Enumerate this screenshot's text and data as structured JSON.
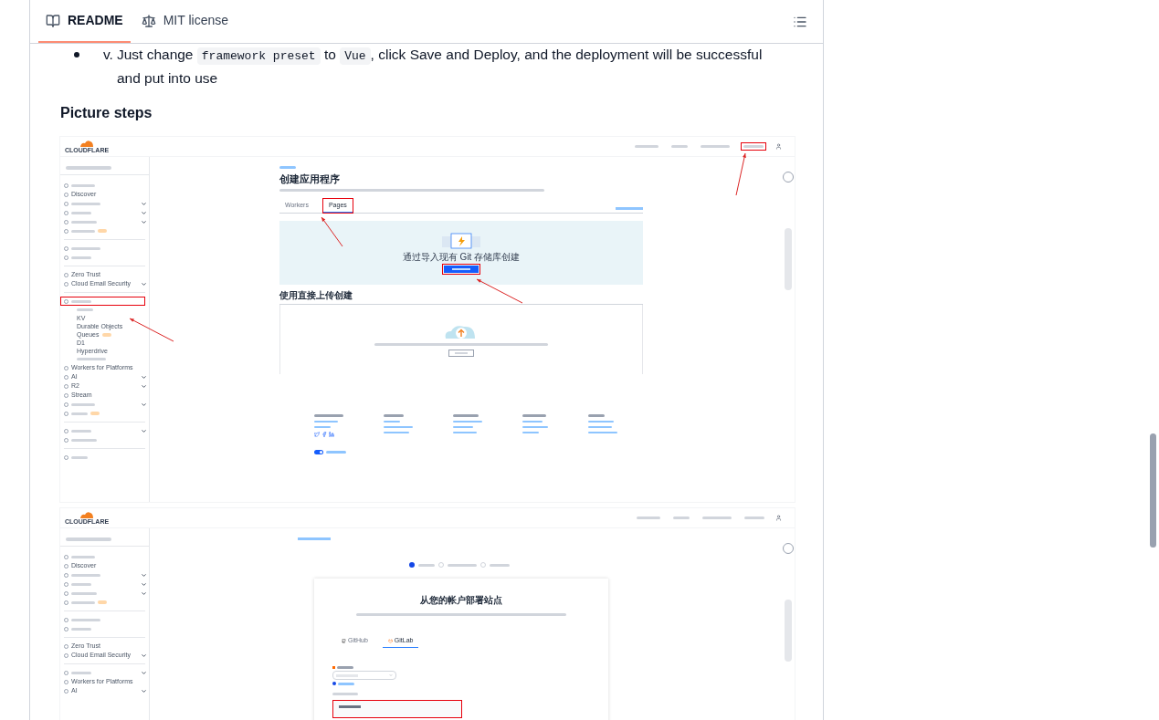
{
  "tabs": [
    {
      "label": "README",
      "selected": true
    },
    {
      "label": "MIT license",
      "selected": false
    }
  ],
  "list_item": {
    "marker": "v.",
    "parts": [
      {
        "kind": "text",
        "text": "Just change "
      },
      {
        "kind": "code",
        "text": "framework preset"
      },
      {
        "kind": "text",
        "text": " to "
      },
      {
        "kind": "code",
        "text": "Vue"
      },
      {
        "kind": "text",
        "text": ", click Save and Deploy, and the deployment will be successful and put into use"
      }
    ]
  },
  "heading": "Picture steps",
  "screenshots": [
    {
      "kind": "create-app",
      "logo": "CLOUDFLARE",
      "topbar": [
        {
          "highlighted": false
        },
        {
          "highlighted": false
        },
        {
          "highlighted": false
        },
        {
          "highlighted": true
        }
      ],
      "sidebar": [
        {
          "kind": "blurred",
          "chevron": false,
          "badge": false,
          "highlighted": false
        },
        {
          "kind": "label",
          "label": "Discover",
          "chevron": false,
          "badge": false,
          "highlighted": false
        },
        {
          "kind": "blurred",
          "chevron": true,
          "badge": false,
          "highlighted": false
        },
        {
          "kind": "blurred",
          "chevron": true,
          "badge": false,
          "highlighted": false
        },
        {
          "kind": "blurred",
          "chevron": true,
          "badge": false,
          "highlighted": false
        },
        {
          "kind": "blurred",
          "chevron": false,
          "badge": true,
          "highlighted": false
        },
        {
          "kind": "divider"
        },
        {
          "kind": "blurred",
          "chevron": false,
          "badge": false,
          "highlighted": false
        },
        {
          "kind": "blurred",
          "chevron": false,
          "badge": false,
          "highlighted": false
        },
        {
          "kind": "divider"
        },
        {
          "kind": "label",
          "label": "Zero Trust",
          "chevron": false,
          "badge": false,
          "highlighted": false
        },
        {
          "kind": "label",
          "label": "Cloud Email Security",
          "chevron": true,
          "badge": false,
          "highlighted": false
        },
        {
          "kind": "divider"
        },
        {
          "kind": "blurred",
          "chevron": false,
          "badge": false,
          "highlighted": true
        },
        {
          "kind": "sub",
          "badge": false
        },
        {
          "kind": "sub",
          "label": "KV",
          "badge": false
        },
        {
          "kind": "sub",
          "label": "Durable Objects",
          "badge": false
        },
        {
          "kind": "sub",
          "label": "Queues",
          "badge": true
        },
        {
          "kind": "sub",
          "label": "D1",
          "badge": false
        },
        {
          "kind": "sub",
          "label": "Hyperdrive",
          "badge": false
        },
        {
          "kind": "sub",
          "badge": false
        },
        {
          "kind": "label",
          "label": "Workers for Platforms",
          "chevron": false,
          "badge": false,
          "highlighted": false
        },
        {
          "kind": "label",
          "label": "AI",
          "chevron": true,
          "badge": false,
          "highlighted": false
        },
        {
          "kind": "label",
          "label": "R2",
          "chevron": true,
          "badge": false,
          "highlighted": false
        },
        {
          "kind": "label",
          "label": "Stream",
          "chevron": false,
          "badge": false,
          "highlighted": false
        },
        {
          "kind": "blurred",
          "chevron": true,
          "badge": false,
          "highlighted": false
        },
        {
          "kind": "blurred",
          "chevron": false,
          "badge": true,
          "highlighted": false
        },
        {
          "kind": "divider"
        },
        {
          "kind": "blurred",
          "chevron": true,
          "badge": false,
          "highlighted": false
        },
        {
          "kind": "blurred",
          "chevron": false,
          "badge": false,
          "highlighted": false
        },
        {
          "kind": "divider"
        },
        {
          "kind": "blurred",
          "chevron": false,
          "badge": false,
          "highlighted": false
        }
      ],
      "title": "创建应用程序",
      "tabs": [
        {
          "label": "Workers",
          "selected": false,
          "highlighted": false
        },
        {
          "label": "Pages",
          "selected": true,
          "highlighted": true
        }
      ],
      "git_text": "通过导入现有 Git 存储库创建",
      "upload_heading": "使用直接上传创建",
      "cookie_toggle": {
        "on": true
      }
    },
    {
      "kind": "deploy-site",
      "logo": "CLOUDFLARE",
      "topbar": [
        {
          "highlighted": false
        },
        {
          "highlighted": false
        },
        {
          "highlighted": false
        },
        {
          "highlighted": false
        }
      ],
      "sidebar": [
        {
          "kind": "blurred",
          "chevron": false,
          "badge": false,
          "highlighted": false
        },
        {
          "kind": "label",
          "label": "Discover",
          "chevron": false,
          "badge": false,
          "highlighted": false
        },
        {
          "kind": "blurred",
          "chevron": true,
          "badge": false,
          "highlighted": false
        },
        {
          "kind": "blurred",
          "chevron": true,
          "badge": false,
          "highlighted": false
        },
        {
          "kind": "blurred",
          "chevron": true,
          "badge": false,
          "highlighted": false
        },
        {
          "kind": "blurred",
          "chevron": false,
          "badge": true,
          "highlighted": false
        },
        {
          "kind": "divider"
        },
        {
          "kind": "blurred",
          "chevron": false,
          "badge": false,
          "highlighted": false
        },
        {
          "kind": "blurred",
          "chevron": false,
          "badge": false,
          "highlighted": false
        },
        {
          "kind": "divider"
        },
        {
          "kind": "label",
          "label": "Zero Trust",
          "chevron": false,
          "badge": false,
          "highlighted": false
        },
        {
          "kind": "label",
          "label": "Cloud Email Security",
          "chevron": true,
          "badge": false,
          "highlighted": false
        },
        {
          "kind": "divider"
        },
        {
          "kind": "blurred",
          "chevron": true,
          "badge": false,
          "highlighted": false
        },
        {
          "kind": "label",
          "label": "Workers for Platforms",
          "chevron": false,
          "badge": false,
          "highlighted": false
        },
        {
          "kind": "label",
          "label": "AI",
          "chevron": true,
          "badge": false,
          "highlighted": false
        }
      ],
      "title": "从您的帐户部署站点",
      "tabs": [
        {
          "label": "GitHub",
          "selected": false,
          "highlighted": false
        },
        {
          "label": "GitLab",
          "selected": true,
          "highlighted": false
        }
      ]
    }
  ]
}
